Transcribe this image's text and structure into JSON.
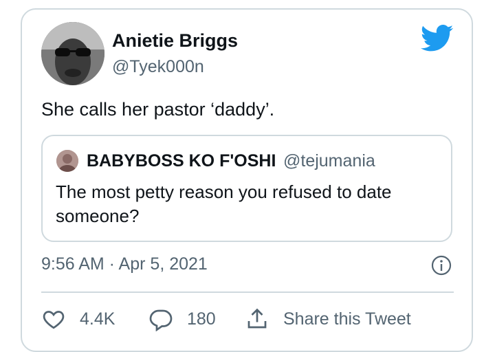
{
  "author": {
    "name": "Anietie Briggs",
    "handle": "@Tyek000n"
  },
  "tweet": {
    "text": "She calls her pastor ‘daddy’."
  },
  "quoted": {
    "name": "BABYBOSS KO F'OSHI",
    "handle": "@tejumania",
    "text": "The most petty reason you refused to date someone?"
  },
  "meta": {
    "timestamp": "9:56 AM · Apr 5, 2021"
  },
  "actions": {
    "likes": "4.4K",
    "replies": "180",
    "share_label": "Share this Tweet"
  },
  "colors": {
    "twitter_blue": "#1d9bf0",
    "secondary_text": "#536471",
    "border": "#cfd9de"
  },
  "icons": [
    "twitter-bird-icon",
    "info-icon",
    "heart-icon",
    "reply-bubble-icon",
    "share-icon"
  ]
}
